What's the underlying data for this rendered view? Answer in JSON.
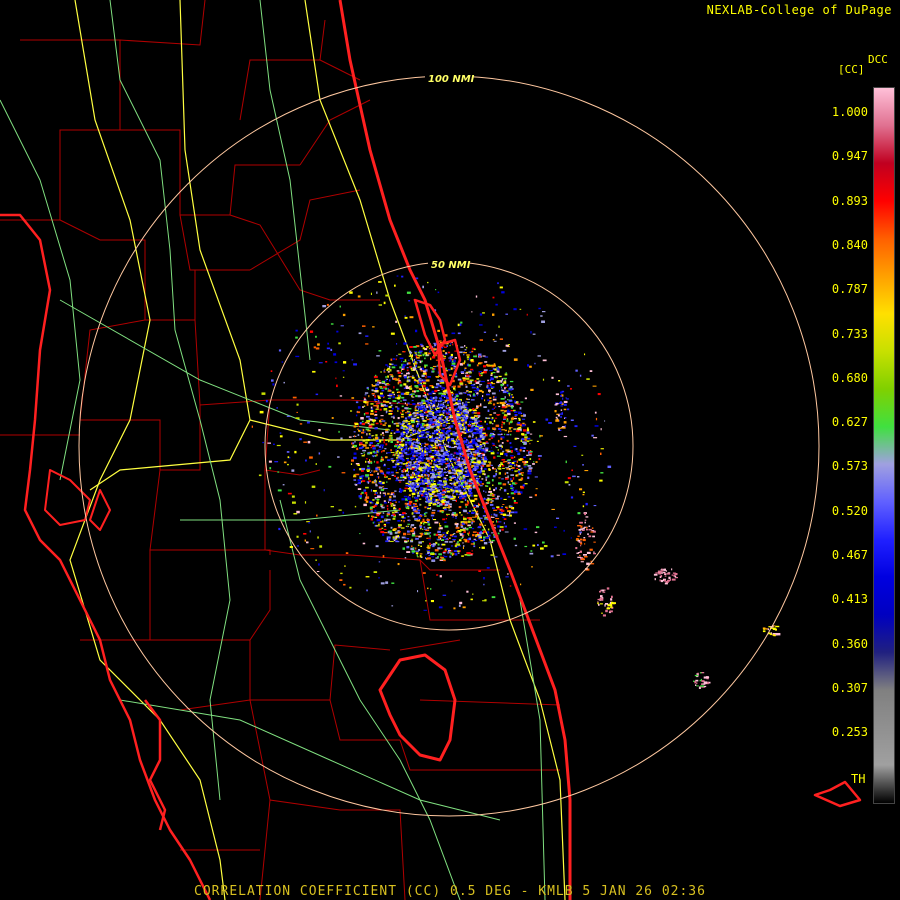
{
  "credit": "NEXLAB-College of DuPage",
  "caption": "CORRELATION COEFFICIENT (CC) 0.5 DEG - KMLB 5 JAN 26 02:36",
  "rings": [
    "100 NMI",
    "50 NMI"
  ],
  "legend": {
    "product": "DCC",
    "unit": "[CC]",
    "ticks": [
      "1.000",
      "0.947",
      "0.893",
      "0.840",
      "0.787",
      "0.733",
      "0.680",
      "0.627",
      "0.573",
      "0.520",
      "0.467",
      "0.413",
      "0.360",
      "0.307",
      "0.253"
    ],
    "bottom_label": "TH",
    "colors": [
      "#ffc0d8",
      "#e07090",
      "#c00020",
      "#ff0000",
      "#ff6000",
      "#ffa000",
      "#ffe000",
      "#c8e000",
      "#80d000",
      "#40e040",
      "#a0a0e0",
      "#6060ff",
      "#2020ff",
      "#0000e0",
      "#0000c0",
      "#202080",
      "#808080",
      "#909090",
      "#a0a0a0",
      "#000000"
    ]
  },
  "colors": {
    "coast": "#ff2020",
    "county": "#c00000",
    "highway_major": "#ffff40",
    "highway_minor": "#80e080",
    "ring": "#ffc8a0"
  }
}
